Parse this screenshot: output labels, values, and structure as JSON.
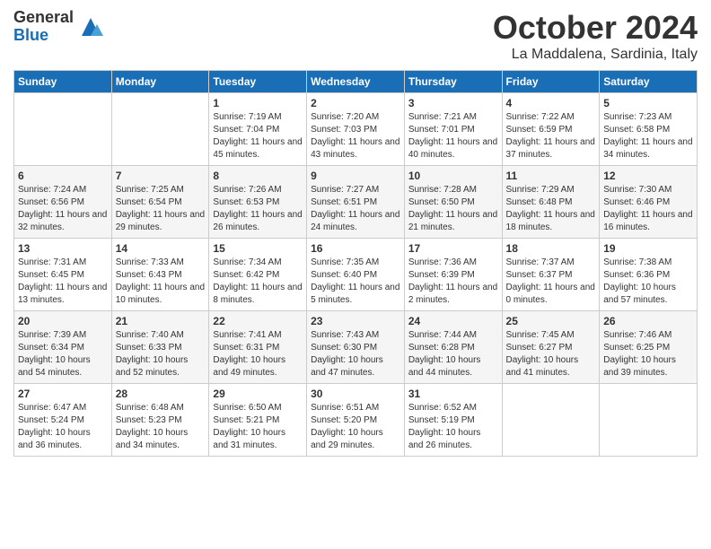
{
  "header": {
    "logo_general": "General",
    "logo_blue": "Blue",
    "month_title": "October 2024",
    "location": "La Maddalena, Sardinia, Italy"
  },
  "days_of_week": [
    "Sunday",
    "Monday",
    "Tuesday",
    "Wednesday",
    "Thursday",
    "Friday",
    "Saturday"
  ],
  "weeks": [
    [
      {
        "day": "",
        "info": ""
      },
      {
        "day": "",
        "info": ""
      },
      {
        "day": "1",
        "info": "Sunrise: 7:19 AM\nSunset: 7:04 PM\nDaylight: 11 hours and 45 minutes."
      },
      {
        "day": "2",
        "info": "Sunrise: 7:20 AM\nSunset: 7:03 PM\nDaylight: 11 hours and 43 minutes."
      },
      {
        "day": "3",
        "info": "Sunrise: 7:21 AM\nSunset: 7:01 PM\nDaylight: 11 hours and 40 minutes."
      },
      {
        "day": "4",
        "info": "Sunrise: 7:22 AM\nSunset: 6:59 PM\nDaylight: 11 hours and 37 minutes."
      },
      {
        "day": "5",
        "info": "Sunrise: 7:23 AM\nSunset: 6:58 PM\nDaylight: 11 hours and 34 minutes."
      }
    ],
    [
      {
        "day": "6",
        "info": "Sunrise: 7:24 AM\nSunset: 6:56 PM\nDaylight: 11 hours and 32 minutes."
      },
      {
        "day": "7",
        "info": "Sunrise: 7:25 AM\nSunset: 6:54 PM\nDaylight: 11 hours and 29 minutes."
      },
      {
        "day": "8",
        "info": "Sunrise: 7:26 AM\nSunset: 6:53 PM\nDaylight: 11 hours and 26 minutes."
      },
      {
        "day": "9",
        "info": "Sunrise: 7:27 AM\nSunset: 6:51 PM\nDaylight: 11 hours and 24 minutes."
      },
      {
        "day": "10",
        "info": "Sunrise: 7:28 AM\nSunset: 6:50 PM\nDaylight: 11 hours and 21 minutes."
      },
      {
        "day": "11",
        "info": "Sunrise: 7:29 AM\nSunset: 6:48 PM\nDaylight: 11 hours and 18 minutes."
      },
      {
        "day": "12",
        "info": "Sunrise: 7:30 AM\nSunset: 6:46 PM\nDaylight: 11 hours and 16 minutes."
      }
    ],
    [
      {
        "day": "13",
        "info": "Sunrise: 7:31 AM\nSunset: 6:45 PM\nDaylight: 11 hours and 13 minutes."
      },
      {
        "day": "14",
        "info": "Sunrise: 7:33 AM\nSunset: 6:43 PM\nDaylight: 11 hours and 10 minutes."
      },
      {
        "day": "15",
        "info": "Sunrise: 7:34 AM\nSunset: 6:42 PM\nDaylight: 11 hours and 8 minutes."
      },
      {
        "day": "16",
        "info": "Sunrise: 7:35 AM\nSunset: 6:40 PM\nDaylight: 11 hours and 5 minutes."
      },
      {
        "day": "17",
        "info": "Sunrise: 7:36 AM\nSunset: 6:39 PM\nDaylight: 11 hours and 2 minutes."
      },
      {
        "day": "18",
        "info": "Sunrise: 7:37 AM\nSunset: 6:37 PM\nDaylight: 11 hours and 0 minutes."
      },
      {
        "day": "19",
        "info": "Sunrise: 7:38 AM\nSunset: 6:36 PM\nDaylight: 10 hours and 57 minutes."
      }
    ],
    [
      {
        "day": "20",
        "info": "Sunrise: 7:39 AM\nSunset: 6:34 PM\nDaylight: 10 hours and 54 minutes."
      },
      {
        "day": "21",
        "info": "Sunrise: 7:40 AM\nSunset: 6:33 PM\nDaylight: 10 hours and 52 minutes."
      },
      {
        "day": "22",
        "info": "Sunrise: 7:41 AM\nSunset: 6:31 PM\nDaylight: 10 hours and 49 minutes."
      },
      {
        "day": "23",
        "info": "Sunrise: 7:43 AM\nSunset: 6:30 PM\nDaylight: 10 hours and 47 minutes."
      },
      {
        "day": "24",
        "info": "Sunrise: 7:44 AM\nSunset: 6:28 PM\nDaylight: 10 hours and 44 minutes."
      },
      {
        "day": "25",
        "info": "Sunrise: 7:45 AM\nSunset: 6:27 PM\nDaylight: 10 hours and 41 minutes."
      },
      {
        "day": "26",
        "info": "Sunrise: 7:46 AM\nSunset: 6:25 PM\nDaylight: 10 hours and 39 minutes."
      }
    ],
    [
      {
        "day": "27",
        "info": "Sunrise: 6:47 AM\nSunset: 5:24 PM\nDaylight: 10 hours and 36 minutes."
      },
      {
        "day": "28",
        "info": "Sunrise: 6:48 AM\nSunset: 5:23 PM\nDaylight: 10 hours and 34 minutes."
      },
      {
        "day": "29",
        "info": "Sunrise: 6:50 AM\nSunset: 5:21 PM\nDaylight: 10 hours and 31 minutes."
      },
      {
        "day": "30",
        "info": "Sunrise: 6:51 AM\nSunset: 5:20 PM\nDaylight: 10 hours and 29 minutes."
      },
      {
        "day": "31",
        "info": "Sunrise: 6:52 AM\nSunset: 5:19 PM\nDaylight: 10 hours and 26 minutes."
      },
      {
        "day": "",
        "info": ""
      },
      {
        "day": "",
        "info": ""
      }
    ]
  ]
}
